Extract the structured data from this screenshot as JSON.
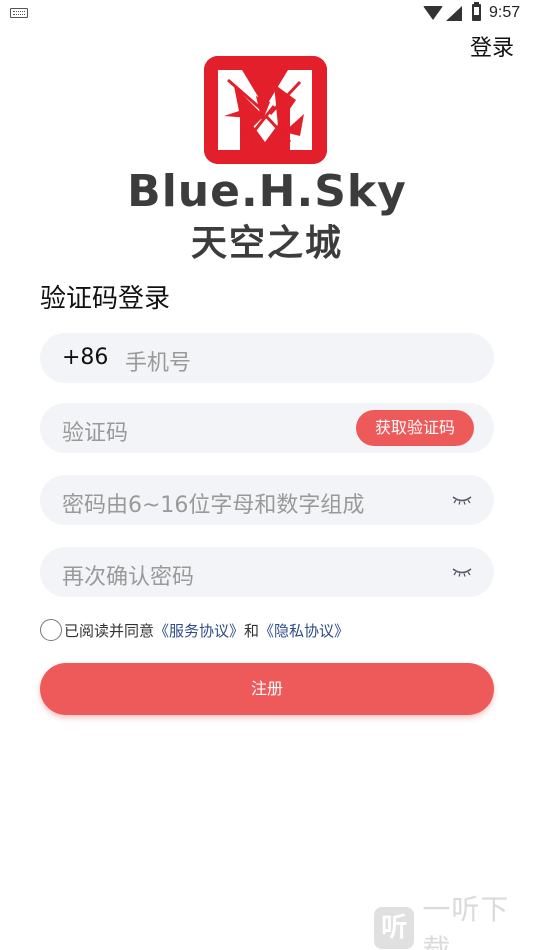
{
  "status_bar": {
    "time": "9:57",
    "icons": [
      "keyboard-icon",
      "wifi-icon",
      "signal-icon",
      "battery-icon"
    ]
  },
  "header": {
    "login_link": "登录"
  },
  "brand": {
    "name_en": "Blue.H.Sky",
    "name_cn": "天空之城",
    "accent_color": "#e21f2a"
  },
  "form": {
    "title": "验证码登录",
    "phone": {
      "prefix": "+86",
      "placeholder": "手机号"
    },
    "code": {
      "placeholder": "验证码",
      "button_label": "获取验证码"
    },
    "password": {
      "placeholder": "密码由6~16位字母和数字组成"
    },
    "confirm_password": {
      "placeholder": "再次确认密码"
    },
    "agreement": {
      "text": "已阅读并同意",
      "service_link": "《服务协议》",
      "and": "和",
      "privacy_link": "《隐私协议》"
    },
    "register_label": "注册",
    "button_color": "#ee5a5a"
  },
  "watermark": {
    "badge": "听",
    "text": "一听下载"
  }
}
